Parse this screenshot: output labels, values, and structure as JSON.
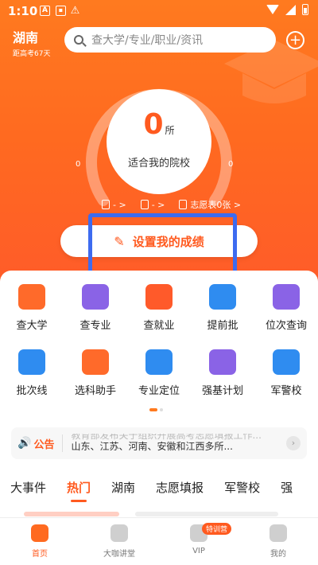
{
  "status_bar": {
    "time": "1:10",
    "icons": [
      "a-box-icon",
      "sim-icon",
      "warning-icon",
      "wifi-icon",
      "signal-icon",
      "battery-icon"
    ]
  },
  "header": {
    "province": "湖南",
    "countdown": "距高考67天",
    "search_placeholder": "查大学/专业/职业/资讯",
    "plus_icon": "plus-icon"
  },
  "gauge": {
    "value": "0",
    "unit": "所",
    "label": "适合我的院校",
    "left_value": "0",
    "right_value": "0"
  },
  "mini_stats": [
    {
      "icon": "document-icon",
      "text": "- >"
    },
    {
      "icon": "book-icon",
      "text": "- >"
    },
    {
      "icon": "mail-icon",
      "text": "志愿表0张 >"
    }
  ],
  "cta": {
    "label": "设置我的成绩",
    "icon": "pen-icon"
  },
  "grid": [
    {
      "label": "查大学",
      "icon": "school-icon",
      "color": "#ff6a2a"
    },
    {
      "label": "查专业",
      "icon": "book-icon",
      "color": "#8a63e6"
    },
    {
      "label": "查就业",
      "icon": "briefcase-icon",
      "color": "#ff5a2a"
    },
    {
      "label": "提前批",
      "icon": "calendar-check-icon",
      "color": "#2f8cf0"
    },
    {
      "label": "位次查询",
      "icon": "trend-chart-icon",
      "color": "#8a63e6"
    },
    {
      "label": "批次线",
      "icon": "line-chart-icon",
      "color": "#2f8cf0"
    },
    {
      "label": "选科助手",
      "icon": "card-icon",
      "color": "#ff6a2a"
    },
    {
      "label": "专业定位",
      "icon": "bar-chart-icon",
      "color": "#2f8cf0"
    },
    {
      "label": "强基计划",
      "icon": "checklist-icon",
      "color": "#8a63e6"
    },
    {
      "label": "军警校",
      "icon": "shield-star-icon",
      "color": "#2f8cf0"
    }
  ],
  "notice": {
    "tag": "公告",
    "line1": "教育部发布关于组织开展高考志愿填报工作...",
    "line2": "山东、江苏、河南、安徽和江西多所..."
  },
  "tabs": [
    "大事件",
    "热门",
    "湖南",
    "志愿填报",
    "军警校",
    "强"
  ],
  "active_tab": "热门",
  "bottom_nav": [
    {
      "label": "首页",
      "icon": "home-icon",
      "active": true
    },
    {
      "label": "大咖讲堂",
      "icon": "play-video-icon",
      "active": false
    },
    {
      "label": "VIP",
      "icon": "vip-icon",
      "badge": "特训营",
      "active": false
    },
    {
      "label": "我的",
      "icon": "profile-icon",
      "active": false
    }
  ],
  "accent_color": "#ff5a1f"
}
